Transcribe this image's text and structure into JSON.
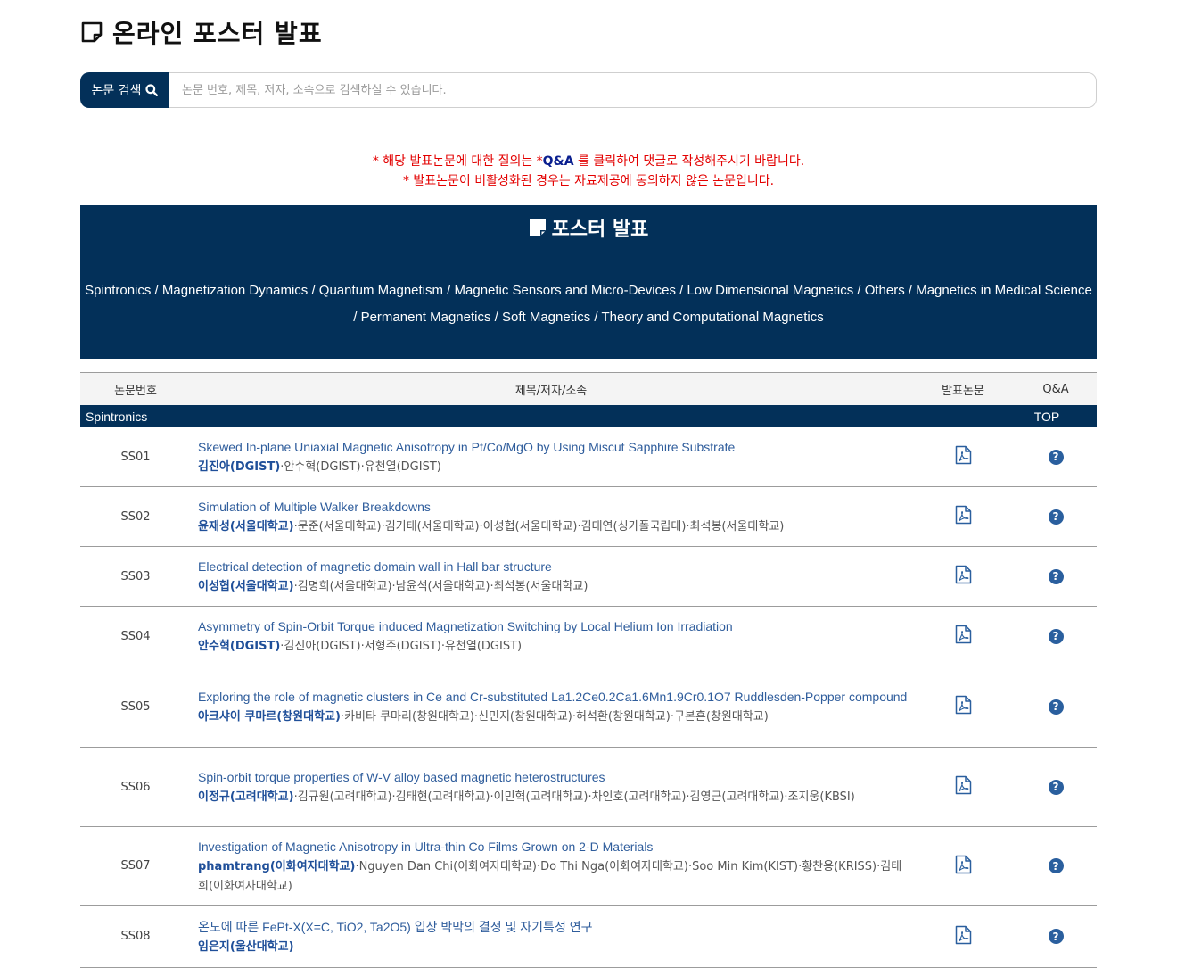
{
  "page": {
    "title": "온라인 포스터 발표"
  },
  "search": {
    "button_label": "논문 검색",
    "placeholder": "논문 번호, 제목, 저자, 소속으로 검색하실 수 있습니다."
  },
  "notice": {
    "line1_before": "* 해당 발표논문에 대한 질의는 *",
    "line1_emph": "Q&A",
    "line1_after": " 를 클릭하여 댓글로 작성해주시기 바랍니다.",
    "line2": "* 발표논문이 비활성화된 경우는 자료제공에 동의하지 않은 논문입니다."
  },
  "banner": {
    "title": "포스터 발표",
    "categories_line1": "Spintronics / Magnetization Dynamics / Quantum Magnetism / Magnetic Sensors and Micro-Devices / Low Dimensional Magnetics / Others / Magnetics in Medical Science",
    "categories_line2": "/ Permanent Magnetics / Soft Magnetics / Theory and Computational Magnetics"
  },
  "table": {
    "headers": {
      "no": "논문번호",
      "title": "제목/저자/소속",
      "pdf": "발표논문",
      "qa": "Q&A"
    },
    "section": {
      "name": "Spintronics",
      "top_label": "TOP"
    },
    "rows": [
      {
        "no": "SS01",
        "title": "Skewed In-plane Uniaxial Magnetic Anisotropy in Pt/Co/MgO by Using Miscut Sapphire Substrate",
        "lead": "김진아(DGIST)",
        "others": "·안수혁(DGIST)·유천열(DGIST)"
      },
      {
        "no": "SS02",
        "title": "Simulation of Multiple Walker Breakdowns",
        "lead": "윤재성(서울대학교)",
        "others": "·문준(서울대학교)·김기태(서울대학교)·이성협(서울대학교)·김대연(싱가폴국립대)·최석봉(서울대학교)"
      },
      {
        "no": "SS03",
        "title": "Electrical detection of magnetic domain wall in Hall bar structure",
        "lead": "이성협(서울대학교)",
        "others": "·김명희(서울대학교)·남윤석(서울대학교)·최석봉(서울대학교)"
      },
      {
        "no": "SS04",
        "title": "Asymmetry of Spin-Orbit Torque induced Magnetization Switching by Local Helium Ion Irradiation",
        "lead": "안수혁(DGIST)",
        "others": "·김진아(DGIST)·서형주(DGIST)·유천열(DGIST)"
      },
      {
        "no": "SS05",
        "title": "Exploring the role of magnetic clusters in Ce and Cr-substituted La1.2Ce0.2Ca1.6Mn1.9Cr0.1O7 Ruddlesden-Popper compound",
        "lead": "아크샤이 쿠마르(창원대학교)",
        "others": "·카비타 쿠마리(창원대학교)·신민지(창원대학교)·허석환(창원대학교)·구본흔(창원대학교)"
      },
      {
        "no": "SS06",
        "title": "Spin-orbit torque properties of W-V alloy based magnetic heterostructures",
        "lead": "이정규(고려대학교)",
        "others": "·김규원(고려대학교)·김태현(고려대학교)·이민혁(고려대학교)·차인호(고려대학교)·김영근(고려대학교)·조지웅(KBSI)"
      },
      {
        "no": "SS07",
        "title": "Investigation of Magnetic Anisotropy in Ultra-thin Co Films Grown on 2-D Materials",
        "lead": "phamtrang(이화여자대학교)",
        "others": "·Nguyen Dan Chi(이화여자대학교)·Do Thi Nga(이화여자대학교)·Soo Min Kim(KIST)·황찬용(KRISS)·김태희(이화여자대학교)"
      },
      {
        "no": "SS08",
        "title": "온도에 따른 FePt-X(X=C, TiO2, Ta2O5) 입상 박막의 결정 및 자기특성 연구",
        "lead": "임은지(울산대학교)",
        "others": ""
      }
    ],
    "qa_glyph": "?"
  }
}
